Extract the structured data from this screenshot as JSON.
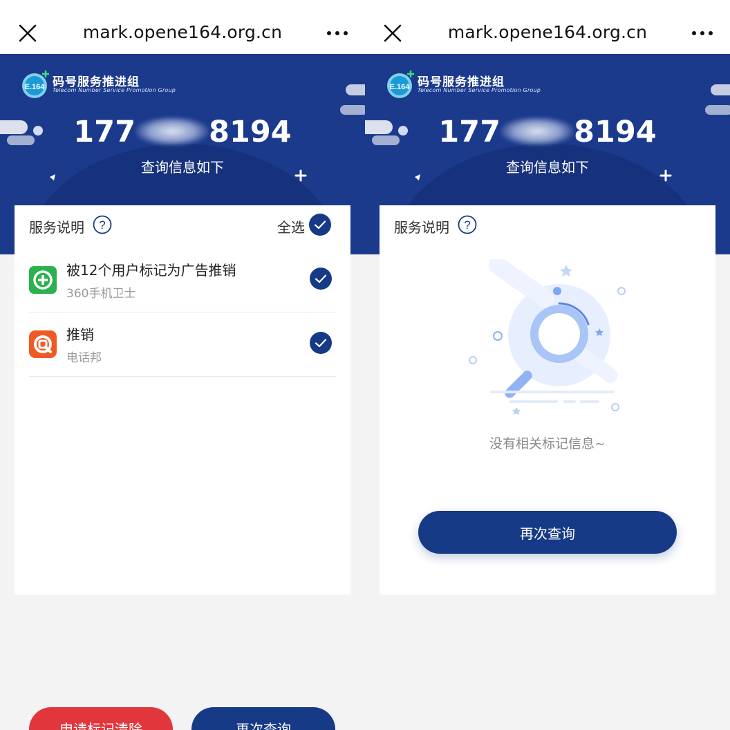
{
  "browser": {
    "url": "mark.opene164.org.cn"
  },
  "banner": {
    "logo_text": "E.164",
    "org_name_cn": "码号服务推进组",
    "org_name_en": "Telecom Number Service  Promotion Group",
    "phone_prefix": "177",
    "phone_suffix": "8194",
    "subtitle": "查询信息如下"
  },
  "left": {
    "service_label": "服务说明",
    "select_all_label": "全选",
    "items": [
      {
        "title": "被12个用户标记为广告推销",
        "source": "360手机卫士",
        "icon": "360-security-icon"
      },
      {
        "title": "推销",
        "source": "电话邦",
        "icon": "dianhuabang-icon"
      }
    ],
    "buttons": {
      "clear": "申请标记清除",
      "requery": "再次查询"
    }
  },
  "right": {
    "service_label": "服务说明",
    "empty_text": "没有相关标记信息~",
    "requery": "再次查询"
  },
  "colors": {
    "brand_blue": "#163a86",
    "banner_blue": "#1b3a8c",
    "red": "#e0363c",
    "icon_green": "#2bb24c",
    "icon_orange": "#ef5a24"
  }
}
